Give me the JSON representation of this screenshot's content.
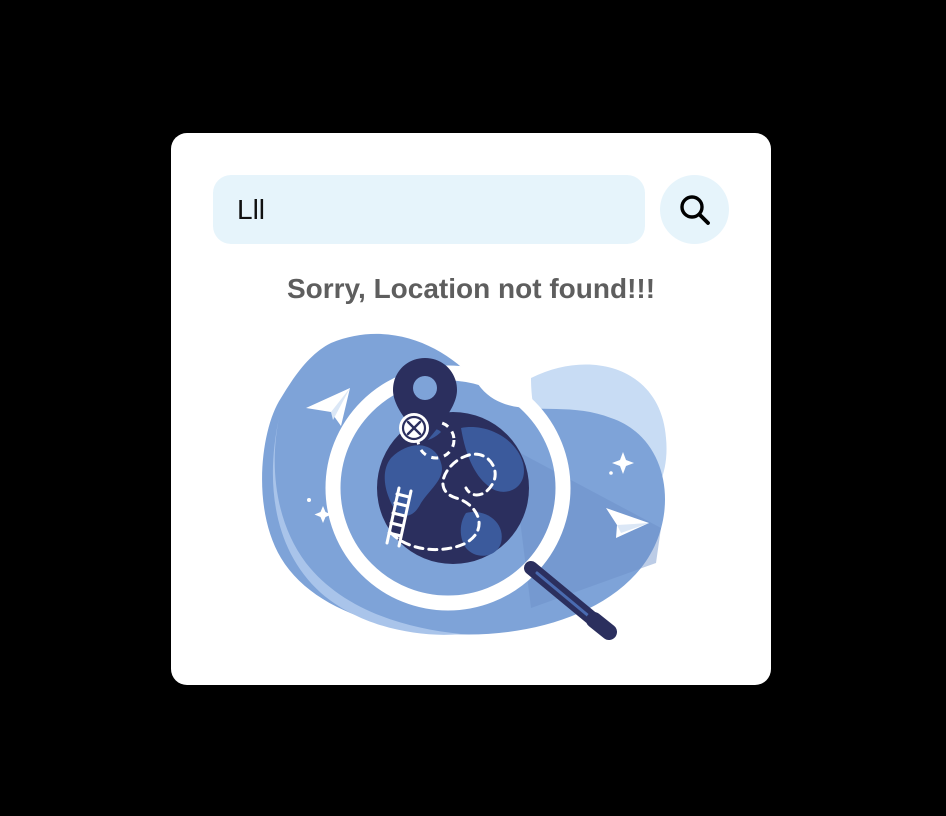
{
  "search": {
    "value": "Lll",
    "button_icon": "search-icon"
  },
  "message": {
    "text": "Sorry, Location not found!!!"
  },
  "illustration": {
    "name": "location-not-found-illustration",
    "icons": [
      "paper-plane-icon",
      "map-pin-icon",
      "close-icon",
      "globe-icon",
      "magnifying-glass-icon",
      "ladder-icon",
      "sparkle-icon"
    ]
  },
  "colors": {
    "page_background": "#000000",
    "card_background": "#ffffff",
    "input_background": "#e6f4fb",
    "message_text": "#5e5e5e",
    "blob_light": "#c8dcf4",
    "blob_mid": "#7ea3d8",
    "navy": "#2b2f5e",
    "globe_land": "#3b5a9c"
  }
}
